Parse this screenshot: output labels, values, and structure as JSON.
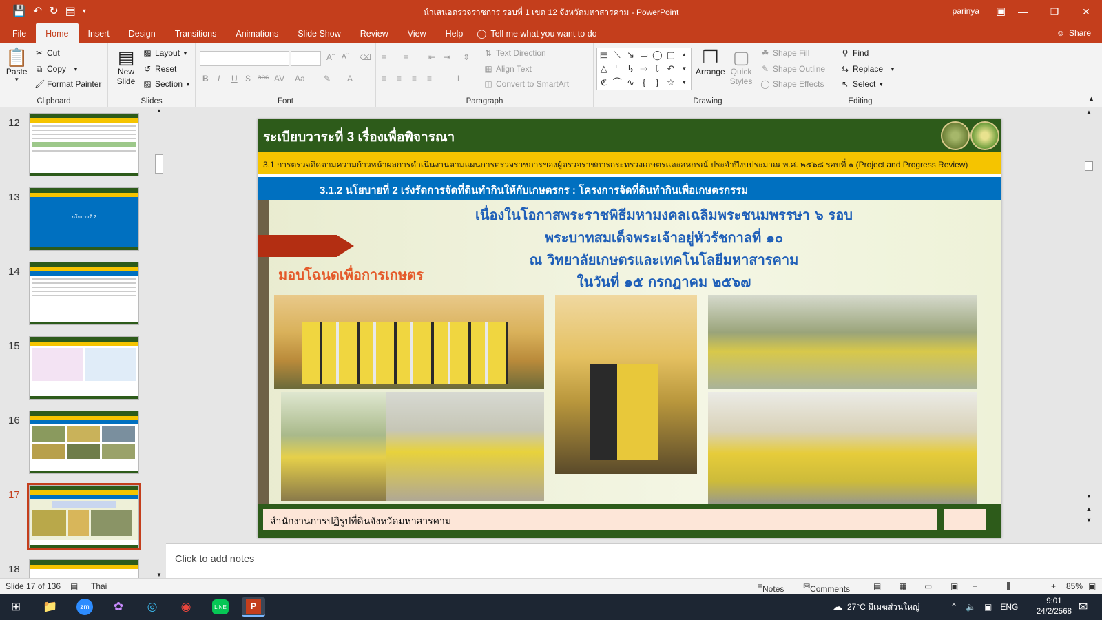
{
  "window": {
    "title": "นำเสนอตรวจราชการ รอบที่ 1 เขต 12 จังหวัดมหาสารคาม  -  PowerPoint",
    "user": "parinya"
  },
  "tabs": [
    {
      "label": "File"
    },
    {
      "label": "Home"
    },
    {
      "label": "Insert"
    },
    {
      "label": "Design"
    },
    {
      "label": "Transitions"
    },
    {
      "label": "Animations"
    },
    {
      "label": "Slide Show"
    },
    {
      "label": "Review"
    },
    {
      "label": "View"
    },
    {
      "label": "Help"
    }
  ],
  "tell_me": "Tell me what you want to do",
  "share_label": "Share",
  "ribbon": {
    "clipboard": {
      "paste": "Paste",
      "cut": "Cut",
      "copy": "Copy",
      "format_painter": "Format Painter",
      "label": "Clipboard"
    },
    "slides": {
      "new_slide": "New Slide",
      "layout": "Layout",
      "reset": "Reset",
      "section": "Section",
      "label": "Slides"
    },
    "font": {
      "label": "Font"
    },
    "paragraph": {
      "text_direction": "Text Direction",
      "align_text": "Align Text",
      "convert_smartart": "Convert to SmartArt",
      "label": "Paragraph"
    },
    "drawing": {
      "arrange": "Arrange",
      "quick_styles": "Quick Styles",
      "shape_fill": "Shape Fill",
      "shape_outline": "Shape Outline",
      "shape_effects": "Shape Effects",
      "label": "Drawing"
    },
    "editing": {
      "find": "Find",
      "replace": "Replace",
      "select": "Select",
      "label": "Editing"
    }
  },
  "thumbnails": [
    {
      "num": "12",
      "style": "table"
    },
    {
      "num": "13",
      "style": "blue-title",
      "text": "นโยบายที่ 2"
    },
    {
      "num": "14",
      "style": "table"
    },
    {
      "num": "15",
      "style": "mixed"
    },
    {
      "num": "16",
      "style": "photos"
    },
    {
      "num": "17",
      "style": "photos",
      "active": true
    },
    {
      "num": "18",
      "style": "table"
    }
  ],
  "slide": {
    "header_title": "ระเบียบวาระที่ 3 เรื่องเพื่อพิจารณา",
    "yellow_bar": "3.1 การตรวจติดตามความก้าวหน้าผลการดำเนินงานตามแผนการตรวจราชการของผู้ตรวจราชการกระทรวงเกษตรและสหกรณ์ ประจำปีงบประมาณ พ.ศ. ๒๕๖๘ รอบที่ ๑ (Project and Progress Review)",
    "blue_bar": "3.1.2 นโยบายที่ 2 เร่งรัดการจัดที่ดินทำกินให้กับเกษตรกร : โครงการจัดที่ดินทำกินเพื่อเกษตรกรรม",
    "headline_1": "เนื่องในโอกาสพระราชพิธีมหามงคลเฉลิมพระชนมพรรษา ๖ รอบ",
    "headline_2": "พระบาทสมเด็จพระเจ้าอยู่หัวรัชกาลที่ ๑๐",
    "headline_3": "ณ วิทยาลัยเกษตรและเทคโนโลยีมหาสารคาม",
    "headline_4": "ในวันที่ ๑๕ กรกฎาคม ๒๕๖๗",
    "orange_label": "มอบโฉนดเพื่อการเกษตร",
    "footer": "สำนักงานการปฏิรูปที่ดินจังหวัดมหาสารคาม"
  },
  "notes_placeholder": "Click to add notes",
  "status": {
    "slide_count": "Slide 17 of 136",
    "language": "Thai",
    "notes": "Notes",
    "comments": "Comments",
    "zoom": "85%"
  },
  "taskbar": {
    "weather": "27°C  มีเมฆส่วนใหญ่",
    "lang": "ENG",
    "time": "9:01",
    "date": "24/2/2568"
  },
  "colors": {
    "accent": "#c43e1c",
    "slide_green": "#2d5b1a",
    "slide_yellow": "#f5c400",
    "slide_blue": "#0070c0"
  }
}
